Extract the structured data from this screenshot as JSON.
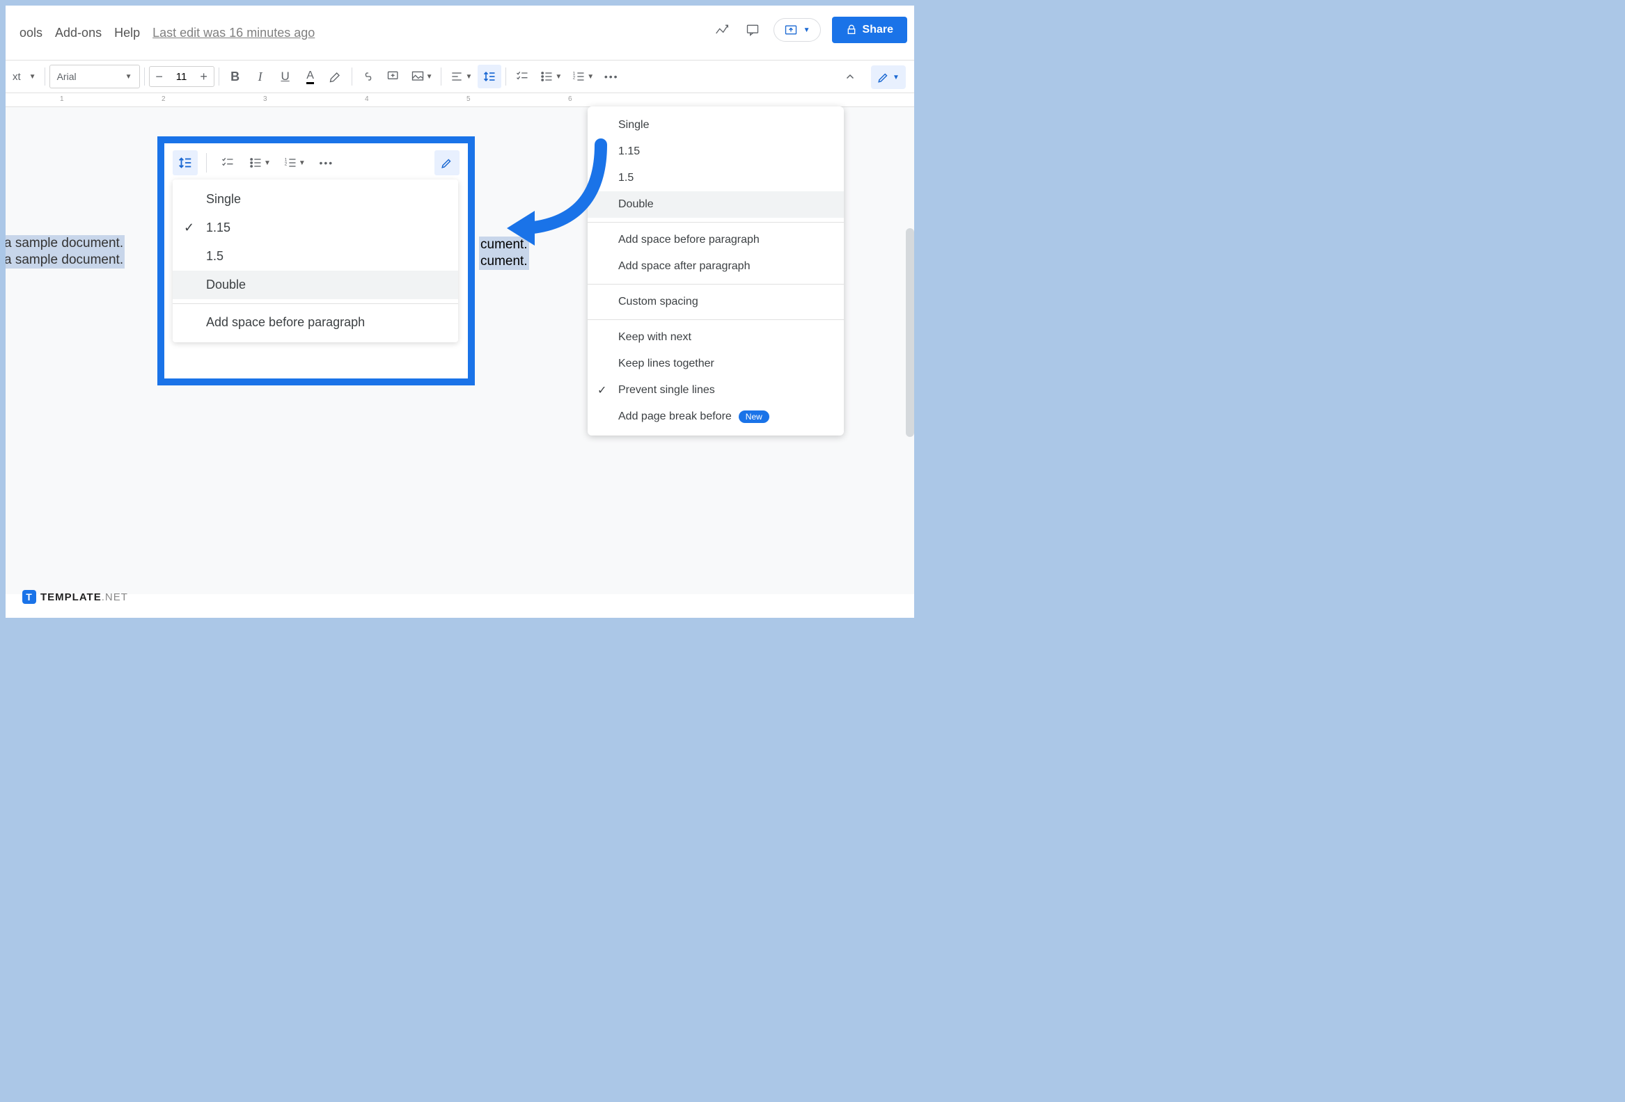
{
  "menu": {
    "tools": "ools",
    "addons": "Add-ons",
    "help": "Help",
    "last_edit": "Last edit was 16 minutes ago"
  },
  "share": {
    "label": "Share"
  },
  "toolbar": {
    "styles": "xt",
    "font": "Arial",
    "size": "11"
  },
  "ruler": {
    "n1": "1",
    "n2": "2",
    "n3": "3",
    "n4": "4",
    "n5": "5",
    "n6": "6"
  },
  "doc": {
    "l1": "a sample document.",
    "l2": "a sample document.",
    "r1": "cument.",
    "r2": "cument."
  },
  "menu1": {
    "single": "Single",
    "v115": "1.15",
    "v15": "1.5",
    "double": "Double",
    "add_before": "Add space before paragraph",
    "add_after": "Add space after paragraph",
    "custom": "Custom spacing",
    "keep_next": "Keep with next",
    "keep_lines": "Keep lines together",
    "prevent": "Prevent single lines",
    "page_break": "Add page break before",
    "badge": "New"
  },
  "menu2": {
    "single": "Single",
    "v115": "1.15",
    "v15": "1.5",
    "double": "Double",
    "add_before": "Add space before paragraph"
  },
  "footer": {
    "t": "TEMPLATE",
    "net": ".NET"
  }
}
